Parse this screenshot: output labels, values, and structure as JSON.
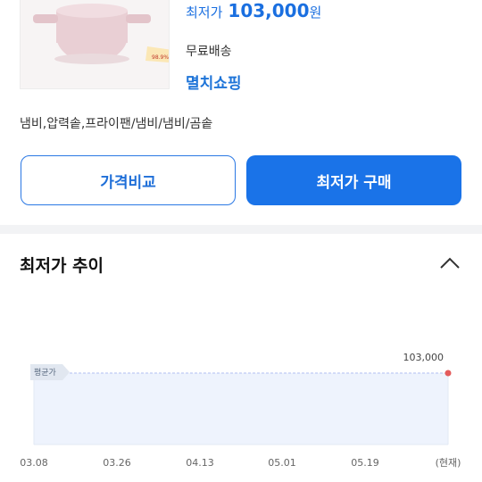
{
  "product": {
    "price_label": "최저가",
    "price_value": "103,000",
    "price_unit": "원",
    "shipping": "무료배송",
    "shop_name": "멸치쇼핑",
    "category_path": "냄비,압력솥,프라이팬/냄비/냄비/곰솥",
    "thumb_badge": "98.9%"
  },
  "buttons": {
    "compare_label": "가격비교",
    "buy_label": "최저가 구매"
  },
  "trend": {
    "title": "최저가 추이",
    "avg_label": "평균가"
  },
  "chart_data": {
    "type": "line",
    "x": [
      "03.08",
      "03.26",
      "04.13",
      "05.01",
      "05.19",
      "(현재)"
    ],
    "series": [
      {
        "values": [
          103000,
          103000,
          103000,
          103000,
          103000,
          103000
        ]
      }
    ],
    "end_label": "103,000",
    "grid": false,
    "colors": {
      "line": "#c7d2f5",
      "point": "#e45b5b",
      "fill": "#eef3fd"
    }
  }
}
